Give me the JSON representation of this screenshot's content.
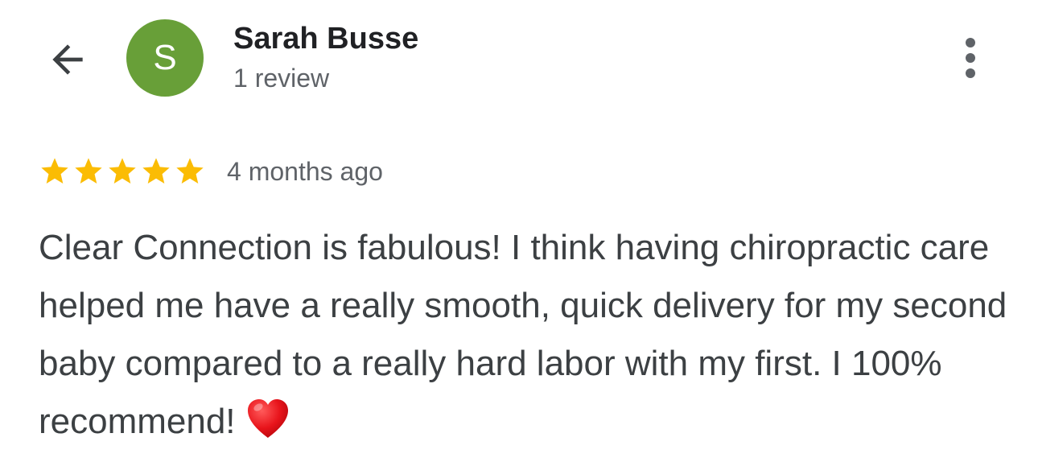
{
  "header": {
    "avatar_letter": "S",
    "avatar_color": "#689f38",
    "name": "Sarah Busse",
    "review_count": "1 review"
  },
  "review": {
    "rating": 5,
    "max_rating": 5,
    "star_color": "#fbbc04",
    "time_ago": "4 months ago",
    "text": "Clear Connection is fabulous! I think having chiropractic care helped me have a really smooth, quick delivery for my second baby compared to a really hard labor with my first. I 100% recommend!",
    "emoji": "heart-icon"
  },
  "icons": {
    "back": "arrow-back-icon",
    "more": "more-vert-icon"
  }
}
